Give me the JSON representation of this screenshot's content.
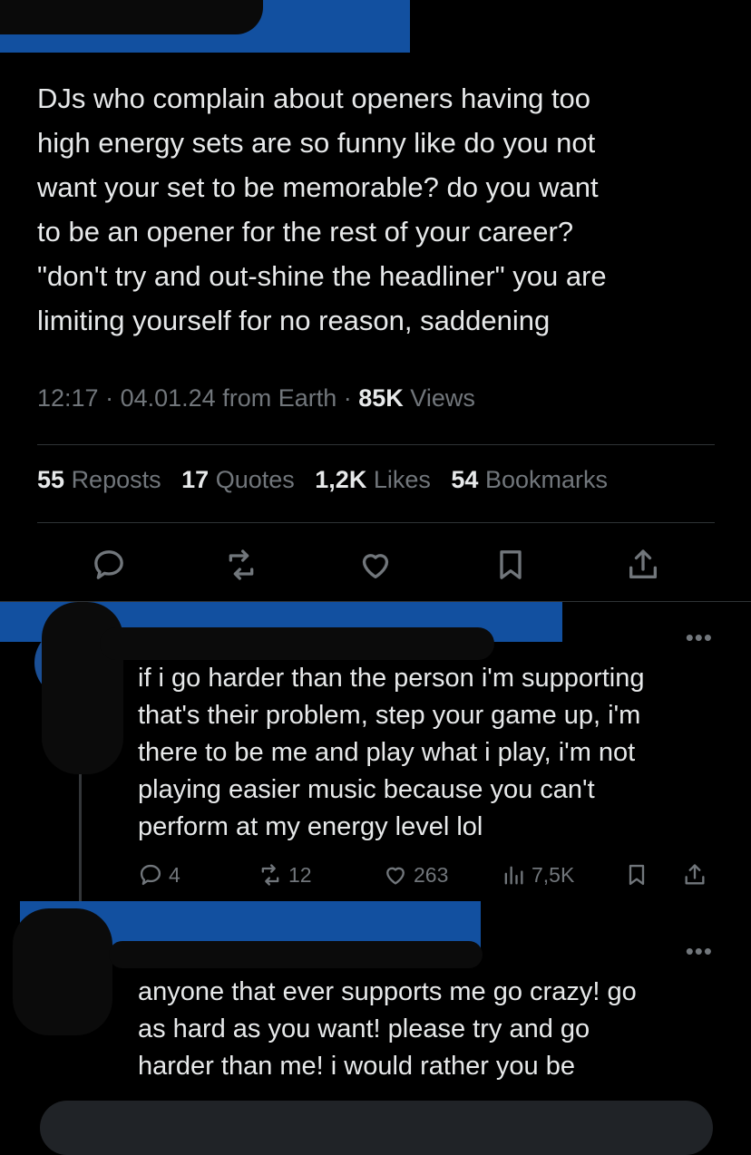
{
  "post": {
    "text": "DJs who complain about openers having too\nhigh energy sets are so funny like do you not\nwant your set to be memorable? do you want\nto be an opener for the rest of your career?\n\"don't try and out-shine the headliner\" you are\nlimiting yourself for no reason, saddening",
    "time": "12:17",
    "date": "04.01.24",
    "source": "from Earth",
    "views_count": "85K",
    "views_label": "Views"
  },
  "stats": {
    "reposts_count": "55",
    "reposts_label": "Reposts",
    "quotes_count": "17",
    "quotes_label": "Quotes",
    "likes_count": "1,2K",
    "likes_label": "Likes",
    "bookmarks_count": "54",
    "bookmarks_label": "Bookmarks"
  },
  "actions": [
    "reply-icon",
    "repost-icon",
    "like-icon",
    "bookmark-icon",
    "share-icon"
  ],
  "replies": [
    {
      "more": "•••",
      "text": "if i go harder than the person i'm supporting\nthat's their problem, step your game up, i'm\nthere to be me and play what i play, i'm not\nplaying easier music because you can't\nperform at my energy level lol",
      "reply_count": "4",
      "repost_count": "12",
      "like_count": "263",
      "view_count": "7,5K"
    },
    {
      "more": "•••",
      "text": "anyone that ever supports me go crazy! go\nas hard as you want! please try and go\nharder than me! i would rather you be"
    }
  ],
  "colors": {
    "background": "#000000",
    "text": "#e7e9ea",
    "muted": "#71767b",
    "redaction_blue": "#1250a0"
  }
}
